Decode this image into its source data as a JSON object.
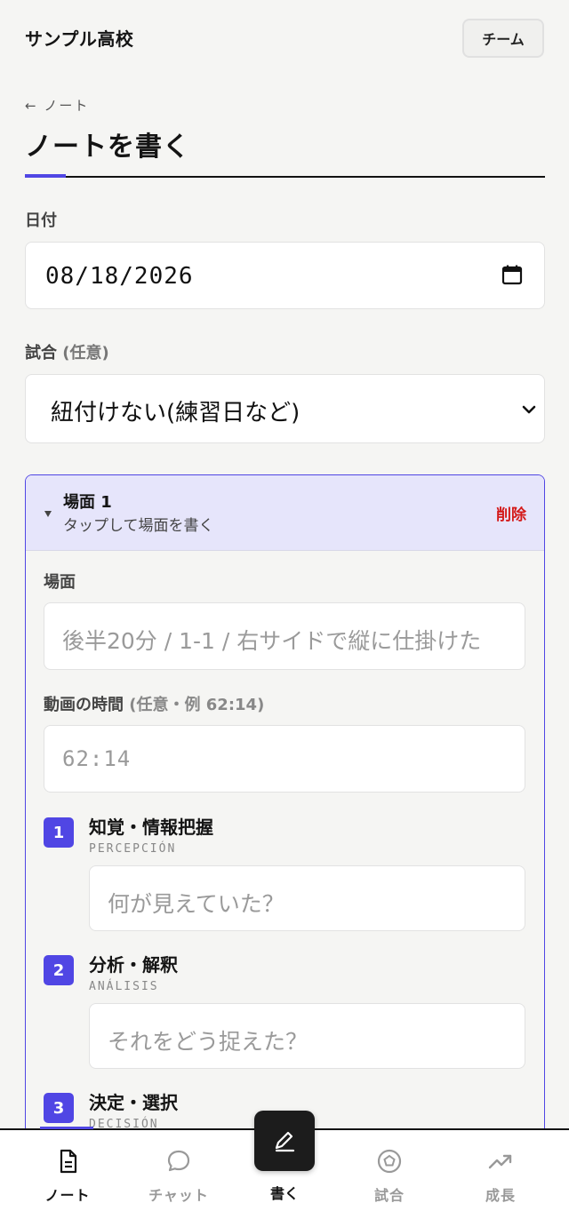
{
  "header": {
    "school_name": "サンプル高校",
    "team_button": "チーム"
  },
  "nav": {
    "back_label": "← ノート",
    "page_title": "ノートを書く"
  },
  "form": {
    "date_label": "日付",
    "date_value": "08/18/2026",
    "match_label": "試合",
    "match_optional": "(任意)",
    "match_value": "紐付けない(練習日など)"
  },
  "scene": {
    "title": "場面 1",
    "subtitle": "タップして場面を書く",
    "delete_label": "削除",
    "scene_label": "場面",
    "scene_placeholder": "後半20分 / 1-1 / 右サイドで縦に仕掛けた",
    "time_label": "動画の時間",
    "time_hint": "(任意・例 62:14)",
    "time_placeholder": "62:14",
    "steps": [
      {
        "num": "1",
        "title": "知覚・情報把握",
        "sub": "PERCEPCIÓN",
        "placeholder": "何が見えていた？"
      },
      {
        "num": "2",
        "title": "分析・解釈",
        "sub": "ANÁLISIS",
        "placeholder": "それをどう捉えた？"
      },
      {
        "num": "3",
        "title": "決定・選択",
        "sub": "DECISIÓN",
        "placeholder": ""
      }
    ]
  },
  "tabs": {
    "notes": "ノート",
    "chat": "チャット",
    "write": "書く",
    "match": "試合",
    "growth": "成長"
  },
  "colors": {
    "accent": "#5046e4",
    "danger": "#d41a1a",
    "background": "#f5f5f3"
  }
}
